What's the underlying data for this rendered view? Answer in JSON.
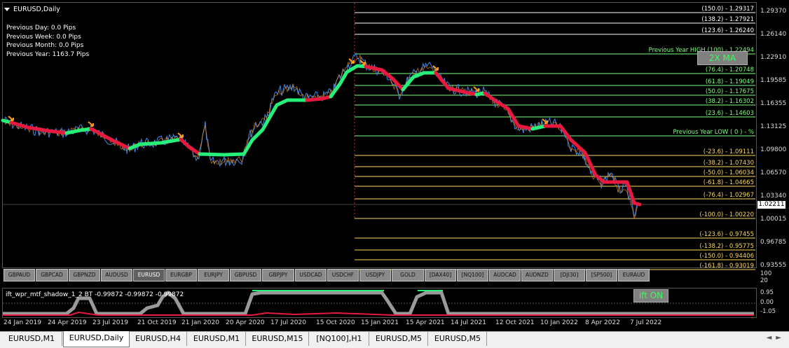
{
  "chart": {
    "title": "EURUSD,Daily",
    "info_lines": [
      "Previous Day: 0.0 Pips",
      "Previous Week: 0.0 Pips",
      "Previous Month: 0.0 Pips",
      "Previous Year: 1163.7 Pips"
    ],
    "ma_button": "2X MA",
    "current_price": "1.02211",
    "price_axis": [
      "1.29370",
      "1.26140",
      "1.22910",
      "1.19585",
      "1.16355",
      "1.13125",
      "1.09800",
      "1.06570",
      "1.03340",
      "1.00015",
      "0.96785",
      "0.93555"
    ],
    "fib_levels": [
      {
        "label": "(150.0) -  1.29317",
        "color": "#ffffff"
      },
      {
        "label": "(138.2) -  1.27921",
        "color": "#ffffff"
      },
      {
        "label": "(123.6) -  1.26240",
        "color": "#ffffff"
      },
      {
        "label": "Previous Year HIGH  (100)  -  1.22494",
        "color": "#7cff7c"
      },
      {
        "label": "(76.4) -  1.20748",
        "color": "#7cff7c"
      },
      {
        "label": "(61.8) -  1.19049",
        "color": "#7cff7c"
      },
      {
        "label": "(50.0) -  1.17675",
        "color": "#7cff7c"
      },
      {
        "label": "(38.2) -  1.16302",
        "color": "#7cff7c"
      },
      {
        "label": "(23.6) -  1.14603",
        "color": "#7cff7c"
      },
      {
        "label": "Previous Year LOW  ( 0 )  -  %",
        "color": "#7cff7c"
      },
      {
        "label": "(-23.6) -  1.09111",
        "color": "#ffd75a"
      },
      {
        "label": "(-38.2) -  1.07430",
        "color": "#ffd75a"
      },
      {
        "label": "(-50.0) -  1.06034",
        "color": "#ffd75a"
      },
      {
        "label": "(-61.8) -  1.04665",
        "color": "#ffd75a"
      },
      {
        "label": "(-76.4) -  1.02967",
        "color": "#ffd75a"
      },
      {
        "label": "(-100.0) -  1.00220",
        "color": "#ffd75a"
      },
      {
        "label": "(-123.6) -  0.97455",
        "color": "#ffd75a"
      },
      {
        "label": "(-138.2) -  0.95775",
        "color": "#ffd75a"
      },
      {
        "label": "(-150.0) -  0.94406",
        "color": "#ffd75a"
      },
      {
        "label": "(-161.8) -  0.93019",
        "color": "#ffd75a"
      }
    ]
  },
  "symbols": [
    "GBPAUD",
    "GBPCAD",
    "GBPNZD",
    "AUDUSD",
    "EURUSD",
    "EURGBP",
    "EURJPY",
    "GBPUSD",
    "GBPJPY",
    "USDCAD",
    "USDCHF",
    "USDJPY",
    "GOLD",
    "[DAX40]",
    "[NQ100]",
    "AUDCAD",
    "AUDNZD",
    "[DJI30]",
    "[SP500]",
    "EURAUD"
  ],
  "active_symbol": "EURUSD",
  "indicator": {
    "title": "ift_wpr_mtf_shadow_1_2 BT -0.99872 -0.99872 -0.99872",
    "button": "ift ON",
    "axis_top": [
      "100",
      "20"
    ],
    "axis": [
      "0.95",
      "0.00",
      "-1.05"
    ]
  },
  "time_axis": [
    "24 Jan 2019",
    "24 Apr 2019",
    "23 Jul 2019",
    "21 Oct 2019",
    "21 Jan 2020",
    "20 Apr 2020",
    "17 Jul 2020",
    "15 Oct 2020",
    "15 Jan 2021",
    "15 Apr 2021",
    "14 Jul 2021",
    "12 Oct 2021",
    "10 Jan 2022",
    "8 Apr 2022",
    "7 Jul 2022"
  ],
  "tabs": [
    "EURUSD,M1",
    "EURUSD,Daily",
    "EURUSD,H4",
    "EURUSD,M1",
    "EURUSD,M15",
    "[NQ100],H1",
    "EURUSD,M5",
    "EURUSD,M5"
  ],
  "active_tab": "EURUSD,Daily",
  "colors": {
    "ma_up": "#27f07a",
    "ma_down": "#e8183f",
    "price": "#3d8ae8",
    "fib_upper": "#ffffff",
    "fib_mid": "#7cff7c",
    "fib_lower": "#ffd75a"
  }
}
